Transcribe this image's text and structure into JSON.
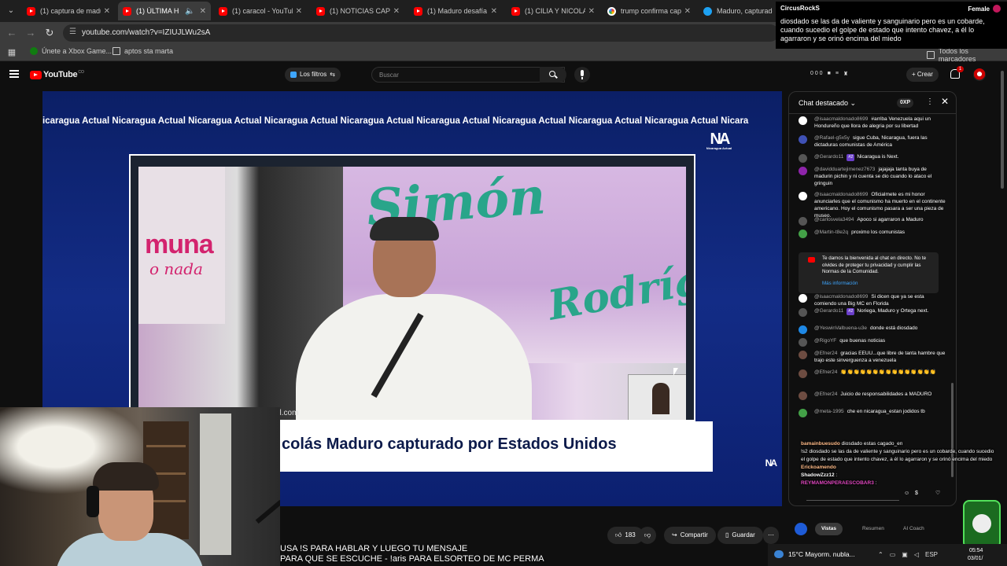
{
  "browser": {
    "tabs": [
      {
        "title": "(1) captura de madur",
        "icon": "youtube-icon",
        "live": false,
        "audio": false
      },
      {
        "title": "(1) ÚLTIMA H",
        "icon": "youtube-icon",
        "live": true,
        "audio": true
      },
      {
        "title": "(1) caracol - YouTube",
        "icon": "youtube-icon",
        "live": false,
        "audio": false
      },
      {
        "title": "(1) NOTICIAS CAP",
        "icon": "youtube-icon",
        "live": true,
        "audio": false
      },
      {
        "title": "(1) Maduro desafía a",
        "icon": "youtube-icon",
        "live": false,
        "audio": false
      },
      {
        "title": "(1) CILIA Y NICOLAS",
        "icon": "youtube-icon",
        "live": false,
        "audio": false
      },
      {
        "title": "trump confirma capt",
        "icon": "google-icon",
        "live": false,
        "audio": false
      },
      {
        "title": "Maduro, capturado,",
        "icon": "site-icon",
        "live": false,
        "audio": false
      }
    ],
    "url": "youtube.com/watch?v=IZIUJLWu2sA",
    "bookmarks": [
      {
        "label": "Únete a Xbox Game...",
        "icon": "xbox-icon"
      },
      {
        "label": "aptos sta marta",
        "icon": "folder-icon"
      },
      {
        "label": "Todos los marcadores",
        "icon": "folder-icon"
      }
    ]
  },
  "alert": {
    "user": "CircusRockS",
    "tag": "Female",
    "message": "diosdado se las da de valiente y sanguinario pero es un cobarde, cuando sucedio el golpe de estado que intento chavez, a él lo agarraron y se orinó encima del miedo"
  },
  "youtube": {
    "logo": "YouTube",
    "logo_suffix": "CO",
    "filters_label": "Los filtros",
    "search_placeholder": "Buscar",
    "ext_counts": "0 0 0",
    "create_label": "Crear",
    "notification_count": "1"
  },
  "video": {
    "ticker": "icaragua Actual Nicaragua Actual Nicaragua Actual Nicaragua Actual Nicaragua Actual Nicaragua Actual Nicaragua Actual Nicaragua Actual Nicaragua Actual Nicara",
    "channel_logo": "NA",
    "channel_logo_sub": "Nicaragua Actual",
    "banner_left_big": "muna",
    "banner_left_small": "o nada",
    "banner_right_1": "Simón",
    "banner_right_2": "Rodríg",
    "domain_fragment": "al.com",
    "lower_third": "colás Maduro capturado por Estados Unidos",
    "corner_logo": "NA"
  },
  "actions": {
    "likes": "183",
    "share": "Compartir",
    "save": "Guardar"
  },
  "subtitle": {
    "line1": "USA !S PARA HABLAR Y LUEGO TU MENSAJE",
    "line2": "PARA QUE SE ESCUCHE - !aris PARA ELSORTEO DE MC PERMA"
  },
  "chat": {
    "title": "Chat destacado",
    "xp": "0XP",
    "messages": [
      {
        "author": "@isaacmaldonado8699",
        "text": "#arriba Venezuela aqui un Hondureño que llora de alegria por su libertad",
        "avatar_color": "#ffffff",
        "badge": ""
      },
      {
        "author": "@Rafael-g5x5y",
        "text": "sigue Cuba, Nicaragua, fuera las dictaduras comunistas de América",
        "avatar_color": "#3f51b5",
        "badge": ""
      },
      {
        "author": "@Gerardo11",
        "text": "Nicaragua is Next.",
        "avatar_color": "#555555",
        "badge": "#2"
      },
      {
        "author": "@davidduartejimenez7673",
        "text": "jajajaja tanta buya de madurin pichin y ni cuenta se dio cuando lo ataco el gringuin",
        "avatar_color": "#8e24aa",
        "badge": ""
      },
      {
        "author": "@isaacmaldonado8699",
        "text": "Oficialmete es mi honor anunciarles que el comunismo ha muerto en el continente americano. Hoy el comunismo pasara a ser una pieza de museo.",
        "avatar_color": "#ffffff",
        "badge": ""
      },
      {
        "author": "@carlosvela3494",
        "text": "Apoco si agarraron a Maduro",
        "avatar_color": "#555555",
        "badge": ""
      },
      {
        "author": "@Martin-t8e2q",
        "text": "proximo los comunistas",
        "avatar_color": "#43a047",
        "badge": ""
      },
      {
        "author": "@isaacmaldonado8699",
        "text": "Si dicen que ya se esta comiendo una Big MC en Florida",
        "avatar_color": "#ffffff",
        "badge": ""
      },
      {
        "author": "@Gerardo11",
        "text": "Noriega, Maduro y Ortega next.",
        "avatar_color": "#555555",
        "badge": "#2"
      },
      {
        "author": "@YeswinValbuena-u3e",
        "text": "donde está diosdado",
        "avatar_color": "#1e88e5",
        "badge": ""
      },
      {
        "author": "@RigoYF",
        "text": "que buenas noticias",
        "avatar_color": "#555555",
        "badge": ""
      },
      {
        "author": "@Efner24",
        "text": "gracias EEUU...que libre de tanta hambre que trajo este sinverguenza a venezuela",
        "avatar_color": "#6d4c41",
        "badge": ""
      },
      {
        "author": "@Efner24",
        "text": "👏👏👏👏👏👏👏👏👏👏👏👏👏👏👏",
        "avatar_color": "#6d4c41",
        "badge": ""
      },
      {
        "author": "@Efner24",
        "text": "Juicio de responsabilidades a MADURO",
        "avatar_color": "#6d4c41",
        "badge": ""
      },
      {
        "author": "@meta-1995",
        "text": "che en nicaragua_estan jodidos tb",
        "avatar_color": "#43a047",
        "badge": ""
      }
    ],
    "welcome": {
      "text": "Te damos la bienvenida al chat en directo. No te olvides de proteger tu privacidad y cumplir las Normas de la Comunidad.",
      "more": "Más información"
    },
    "overlay": [
      {
        "name": "bamainbuesudo",
        "text": "diosdado estas cagado_en"
      },
      {
        "name": "",
        "text": "!s2 diosdado se las da de valiente y sanguinario pero es un cobarde, cuando sucedio el golpe de estado que intento chavez, a él lo agarraron y se orinó encima del miedo"
      },
      {
        "name": "Erickoamendo",
        "text": ""
      },
      {
        "name": "ShadowZzz12",
        "text": ""
      },
      {
        "name": "REYMAMONPERAESCOBAR3",
        "text": ""
      }
    ],
    "tabs": [
      "Vistas",
      "Resumen",
      "AI Coach"
    ]
  },
  "taskbar": {
    "weather": "15°C  Mayorm. nubla...",
    "lang": "ESP",
    "time": "05:54",
    "date": "03/01/"
  }
}
